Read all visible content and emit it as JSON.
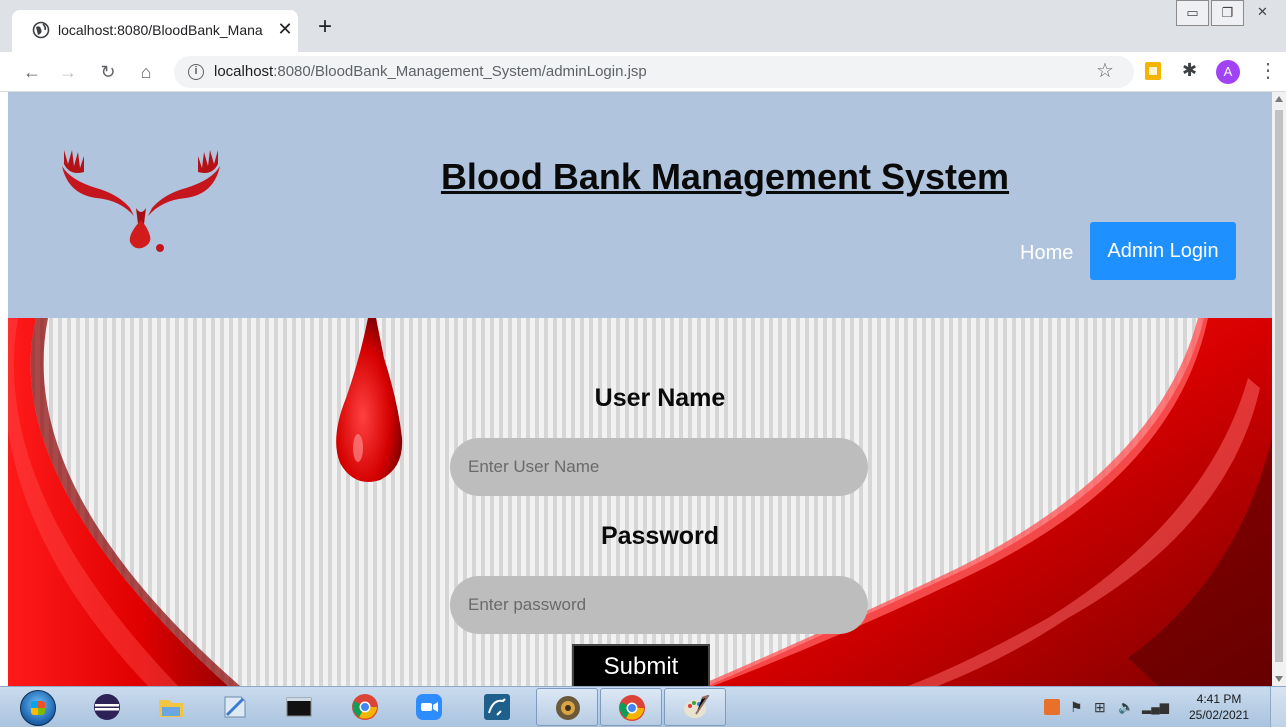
{
  "browser": {
    "tab_title": "localhost:8080/BloodBank_Mana",
    "tab_close": "✕",
    "new_tab": "+",
    "url_host": "localhost",
    "url_rest": ":8080/BloodBank_Management_System/adminLogin.jsp",
    "avatar_letter": "A"
  },
  "site": {
    "title": "Blood Bank Management System",
    "nav": {
      "home": "Home",
      "admin_login": "Admin Login"
    }
  },
  "form": {
    "username_label": "User Name",
    "username_placeholder": "Enter User Name",
    "password_label": "Password",
    "password_placeholder": "Enter password",
    "submit_label": "Submit"
  },
  "taskbar": {
    "clock_time": "4:41 PM",
    "clock_date": "25/02/2021",
    "apps": [
      "eclipse",
      "file-explorer",
      "notepad",
      "command-prompt",
      "chrome",
      "zoom",
      "mysql-workbench",
      "tomcat",
      "chrome",
      "paint"
    ]
  },
  "colors": {
    "header_bg": "#b0c4de",
    "admin_button": "#1e90ff",
    "blood_red": "#e00000"
  }
}
